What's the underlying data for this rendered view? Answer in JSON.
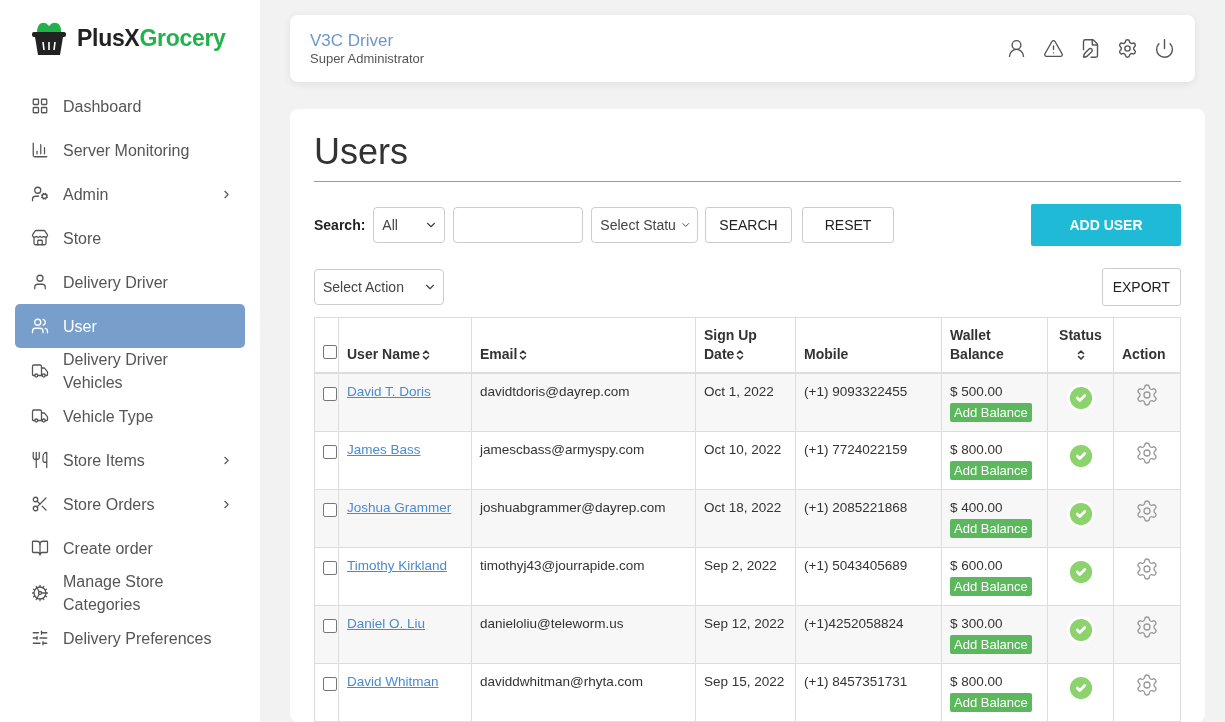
{
  "logo": {
    "text": "PlusX",
    "accent": "Grocery"
  },
  "sidebar": {
    "items": [
      {
        "label": "Dashboard",
        "selected": false,
        "expandable": false
      },
      {
        "label": "Server Monitoring",
        "selected": false,
        "expandable": false
      },
      {
        "label": "Admin",
        "selected": false,
        "expandable": true
      },
      {
        "label": "Store",
        "selected": false,
        "expandable": false
      },
      {
        "label": "Delivery Driver",
        "selected": false,
        "expandable": false
      },
      {
        "label": "User",
        "selected": true,
        "expandable": false
      },
      {
        "label": "Delivery Driver Vehicles",
        "selected": false,
        "expandable": false
      },
      {
        "label": "Vehicle Type",
        "selected": false,
        "expandable": false
      },
      {
        "label": "Store Items",
        "selected": false,
        "expandable": true
      },
      {
        "label": "Store Orders",
        "selected": false,
        "expandable": true
      },
      {
        "label": "Create order",
        "selected": false,
        "expandable": false
      },
      {
        "label": "Manage Store Categories",
        "selected": false,
        "expandable": false
      },
      {
        "label": "Delivery Preferences",
        "selected": false,
        "expandable": false
      }
    ]
  },
  "header": {
    "user_name": "V3C Driver",
    "role": "Super Administrator"
  },
  "page": {
    "title": "Users",
    "search": {
      "label": "Search:",
      "field_select": "All",
      "status_select": "Select Statu",
      "search_button": "SEARCH",
      "reset_button": "RESET",
      "add_button": "ADD USER"
    },
    "action_select": "Select Action",
    "export_button": "EXPORT"
  },
  "table": {
    "select_all_checked": false,
    "columns": [
      {
        "label": "User Name",
        "sortable": true
      },
      {
        "label": "Email",
        "sortable": true
      },
      {
        "label": "Sign Up Date",
        "sortable": true
      },
      {
        "label": "Mobile",
        "sortable": false
      },
      {
        "label": "Wallet Balance",
        "sortable": false
      },
      {
        "label": "Status",
        "sortable": true
      },
      {
        "label": "Action",
        "sortable": false
      }
    ],
    "rows": [
      {
        "checked": false,
        "name": "David T. Doris",
        "email": "davidtdoris@dayrep.com",
        "date": "Oct 1, 2022",
        "mobile": "(+1) 9093322455",
        "balance": "$ 500.00",
        "balance_button": "Add Balance",
        "active": true
      },
      {
        "checked": false,
        "name": "James Bass",
        "email": "jamescbass@armyspy.com",
        "date": "Oct 10, 2022",
        "mobile": "(+1) 7724022159",
        "balance": "$ 800.00",
        "balance_button": "Add Balance",
        "active": true
      },
      {
        "checked": false,
        "name": "Joshua Grammer",
        "email": "joshuabgrammer@dayrep.com",
        "date": "Oct 18, 2022",
        "mobile": "(+1) 2085221868",
        "balance": "$ 400.00",
        "balance_button": "Add Balance",
        "active": true
      },
      {
        "checked": false,
        "name": "Timothy Kirkland",
        "email": "timothyj43@jourrapide.com",
        "date": "Sep 2, 2022",
        "mobile": "(+1) 5043405689",
        "balance": "$ 600.00",
        "balance_button": "Add Balance",
        "active": true
      },
      {
        "checked": false,
        "name": "Daniel O. Liu",
        "email": "danieloliu@teleworm.us",
        "date": "Sep 12, 2022",
        "mobile": "(+1)4252058824",
        "balance": "$ 300.00",
        "balance_button": "Add Balance",
        "active": true
      },
      {
        "checked": false,
        "name": "David Whitman",
        "email": "daviddwhitman@rhyta.com",
        "date": "Sep 15, 2022",
        "mobile": "(+1) 8457351731",
        "balance": "$ 800.00",
        "balance_button": "Add Balance",
        "active": true
      }
    ]
  }
}
